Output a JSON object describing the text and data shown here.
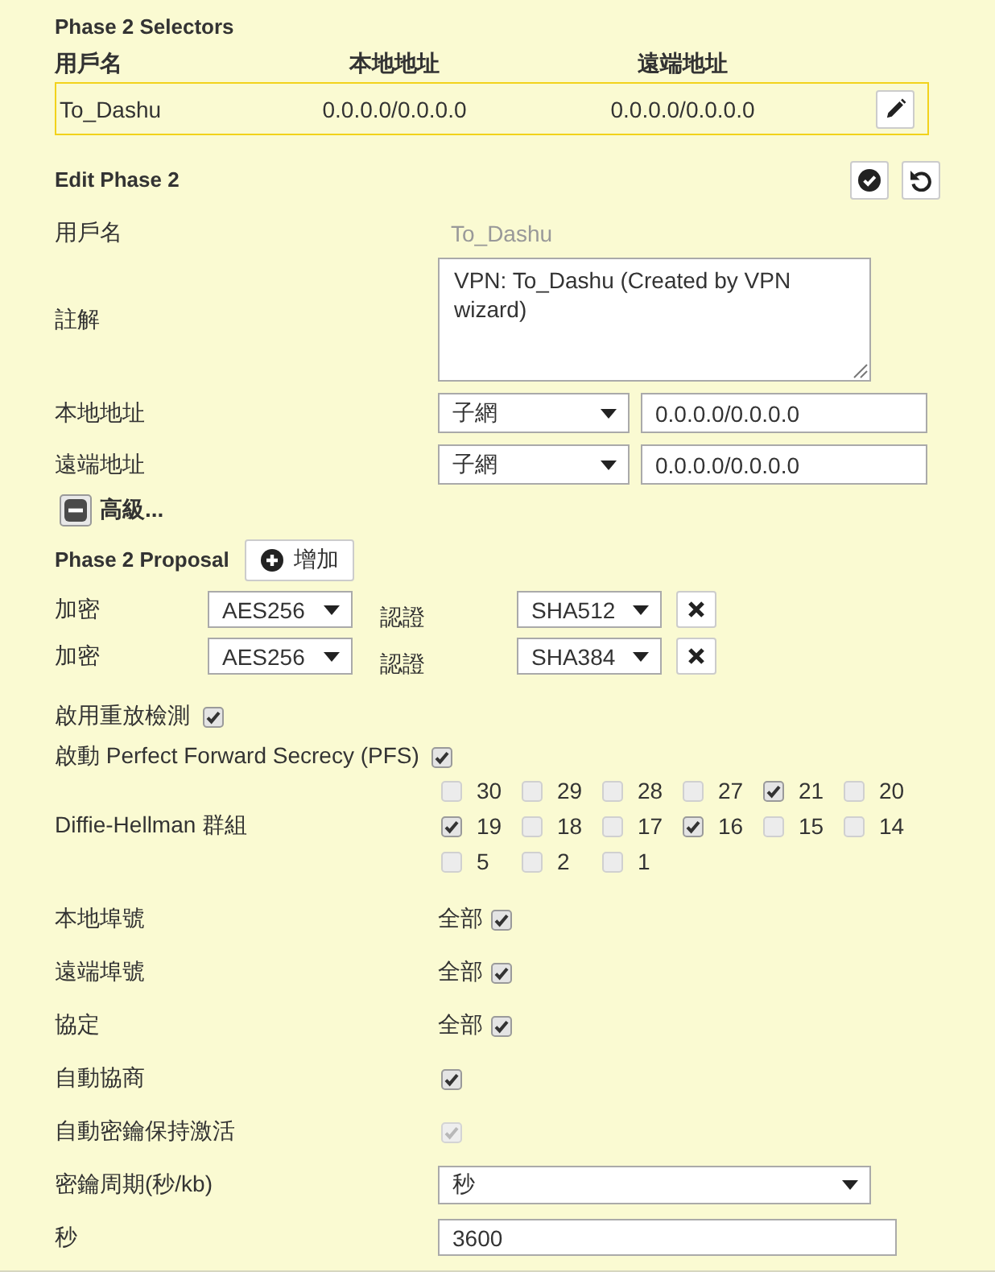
{
  "selectors": {
    "title": "Phase 2 Selectors",
    "columns": [
      "用戶名",
      "本地地址",
      "遠端地址"
    ],
    "rows": [
      {
        "cells": [
          "To_Dashu",
          "0.0.0.0/0.0.0.0",
          "0.0.0.0/0.0.0.0"
        ],
        "selected": true
      }
    ]
  },
  "edit": {
    "title": "Edit Phase 2"
  },
  "fields": [
    {
      "kind": "static",
      "label": "用戶名",
      "value": "To_Dashu"
    },
    {
      "kind": "textarea",
      "label": "註解",
      "value": "VPN: To_Dashu (Created by VPN wizard)"
    },
    {
      "kind": "address",
      "label": "本地地址",
      "type": "子網",
      "value": "0.0.0.0/0.0.0.0"
    },
    {
      "kind": "address",
      "label": "遠端地址",
      "type": "子網",
      "value": "0.0.0.0/0.0.0.0"
    }
  ],
  "advanced": {
    "label": "高級...",
    "expanded": true
  },
  "proposal": {
    "title": "Phase 2 Proposal",
    "add_button": "增加",
    "rows": [
      {
        "encryption_label": "加密",
        "encryption": "AES256",
        "auth_label": "認證",
        "auth": "SHA512"
      },
      {
        "encryption_label": "加密",
        "encryption": "AES256",
        "auth_label": "認證",
        "auth": "SHA384"
      }
    ]
  },
  "toggles": [
    {
      "label": "啟用重放檢測",
      "checked": true
    },
    {
      "label": "啟動 Perfect Forward Secrecy (PFS)",
      "checked": true
    }
  ],
  "dh_groups": {
    "label": "Diffie-Hellman 群組",
    "groups": [
      {
        "label": "30",
        "checked": false
      },
      {
        "label": "29",
        "checked": false
      },
      {
        "label": "28",
        "checked": false
      },
      {
        "label": "27",
        "checked": false
      },
      {
        "label": "21",
        "checked": true
      },
      {
        "label": "20",
        "checked": false
      },
      {
        "label": "19",
        "checked": true
      },
      {
        "label": "18",
        "checked": false
      },
      {
        "label": "17",
        "checked": false
      },
      {
        "label": "16",
        "checked": true
      },
      {
        "label": "15",
        "checked": false
      },
      {
        "label": "14",
        "checked": false
      },
      {
        "label": "5",
        "checked": false
      },
      {
        "label": "2",
        "checked": false
      },
      {
        "label": "1",
        "checked": false
      }
    ]
  },
  "settings": [
    {
      "kind": "all",
      "label": "本地埠號",
      "value": "全部",
      "checked": true,
      "disabled": false
    },
    {
      "kind": "all",
      "label": "遠端埠號",
      "value": "全部",
      "checked": true,
      "disabled": false
    },
    {
      "kind": "all",
      "label": "協定",
      "value": "全部",
      "checked": true,
      "disabled": false
    },
    {
      "kind": "plain",
      "label": "自動協商",
      "checked": true,
      "disabled": false
    },
    {
      "kind": "plain",
      "label": "自動密鑰保持激活",
      "checked": true,
      "disabled": true
    }
  ],
  "key_lifetime": {
    "label": "密鑰周期(秒/kb)",
    "value": "秒"
  },
  "seconds": {
    "label": "秒",
    "value": "3600"
  }
}
